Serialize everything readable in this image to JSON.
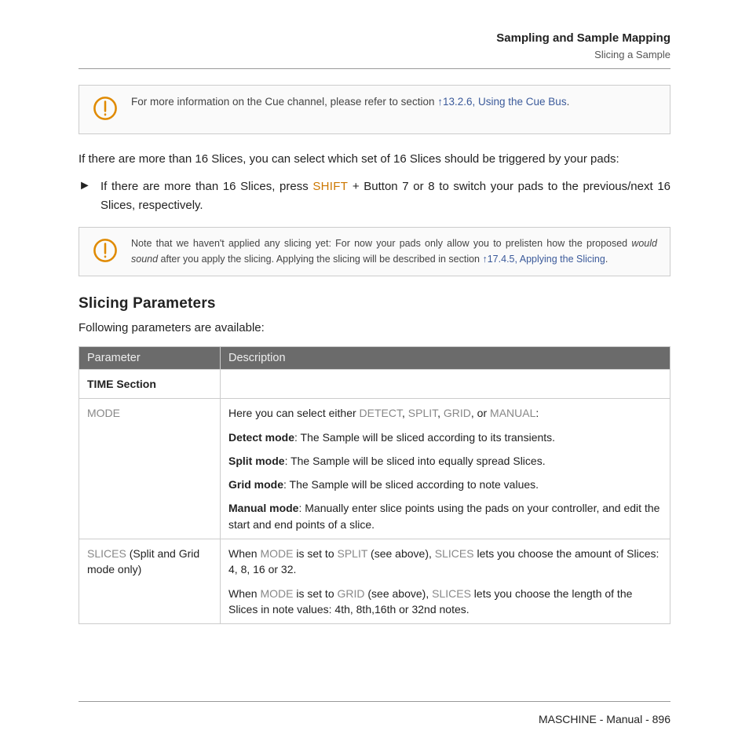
{
  "header": {
    "chapter": "Sampling and Sample Mapping",
    "section": "Slicing a Sample"
  },
  "notes": {
    "cue": {
      "prefix": "For more information on the Cue channel, please refer to section ",
      "link": "↑13.2.6, Using the Cue Bus",
      "suffix": "."
    },
    "apply": {
      "t1": "Note that we haven't applied any slicing yet: For now your pads only allow you to prelisten how the proposed ",
      "t2": "would sound",
      "t3": " after you apply the slicing. Applying the slicing will be described in section ",
      "link": "↑17.4.5, Applying the Slicing",
      "t4": "."
    }
  },
  "paras": {
    "p1": "If there are more than 16 Slices, you can select which set of 16 Slices should be triggered by your pads:",
    "bullet_pre": "If there are more than 16 Slices, press ",
    "bullet_term": "SHIFT",
    "bullet_post": " + Button 7 or 8 to switch your pads to the previous/next 16 Slices, respectively."
  },
  "subhead": "Slicing Parameters",
  "following": "Following parameters are available:",
  "table": {
    "h1": "Parameter",
    "h2": "Description",
    "time_section": "TIME Section",
    "mode_label": "MODE",
    "mode_intro_pre": "Here you can select either ",
    "mode_opts": [
      "DETECT",
      "SPLIT",
      "GRID",
      "MANUAL"
    ],
    "sep": ", ",
    "or": ", or ",
    "colon": ":",
    "detect_label": "Detect mode",
    "detect_text": ": The Sample will be sliced according to its transients.",
    "split_label": "Split mode",
    "split_text": ": The Sample will be sliced into equally spread Slices.",
    "grid_label": "Grid mode",
    "grid_text": ": The Sample will be sliced according to note values.",
    "manual_label": "Manual mode",
    "manual_text": ": Manually enter slice points using the pads on your controller, and edit the start and end points of a slice.",
    "slices_pre": "SLICES",
    "slices_paren": " (Split and Grid mode only)",
    "slices_p1a": "When ",
    "slices_p1b": " is set to ",
    "slices_p1c": " (see above), ",
    "slices_p1d": " lets you choose the amount of Slices: 4, 8, 16 or 32.",
    "slices_p2d": " lets you choose the length of the Slices in note values: 4th, 8th,16th or 32nd notes.",
    "MODE": "MODE",
    "SPLIT": "SPLIT",
    "GRID": "GRID",
    "SLICES": "SLICES"
  },
  "footer": {
    "product": "MASCHINE - Manual - ",
    "page": "896"
  }
}
